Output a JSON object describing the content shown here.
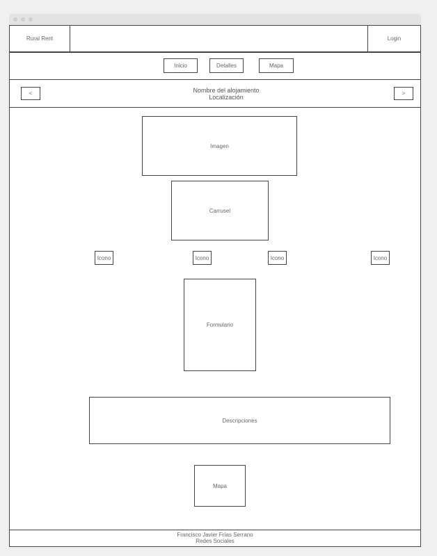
{
  "header": {
    "brand": "Rural Rent",
    "login": "Login"
  },
  "nav": {
    "inicio": "Inicio",
    "detalles": "Detalles",
    "mapa": "Mapa"
  },
  "property": {
    "prev": "<",
    "name": "Nombre del alojamiento",
    "location": "Localización",
    "next": ">"
  },
  "content": {
    "imagen": "Imagen",
    "carrusel": "Carrusel",
    "icons": [
      "Icono",
      "Icono",
      "Icono",
      "Icono"
    ],
    "formulario": "Formulario",
    "descripciones": "Descripciones",
    "mapa": "Mapa"
  },
  "footer": {
    "author": "Francisco Javier Frías Serrano",
    "social": "Redes Sociales"
  }
}
